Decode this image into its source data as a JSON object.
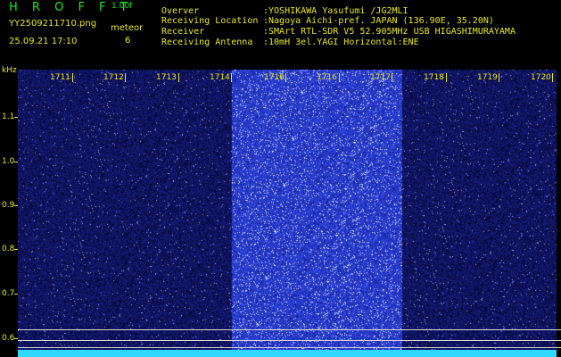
{
  "header": {
    "logo": "H R O F F T",
    "version": "1.00f",
    "filename": "YY2509211710.png",
    "meteor_label": "meteor",
    "datetime": "25.09.21 17:10",
    "meteor_count": "6"
  },
  "info": [
    {
      "key": "Overver",
      "value": ":YOSHIKAWA Yasufumi /JG2MLI"
    },
    {
      "key": "Receiving Location",
      "value": ":Nagoya Aichi-pref. JAPAN (136.90E, 35.20N)"
    },
    {
      "key": "Receiver",
      "value": ":SMArt RTL-SDR V5 52.905MHz USB HIGASHIMURAYAMA"
    },
    {
      "key": "Receiving Antenna",
      "value": ":10mH 3el.YAGI Horizontal:ENE"
    }
  ],
  "spectrogram": {
    "unit": "kHz",
    "time_labels": [
      "1711",
      "1712",
      "1713",
      "1714",
      "1716",
      "1716",
      "1717",
      "1718",
      "1719",
      "1720"
    ],
    "freq_labels": [
      "1.1",
      "1.0",
      "0.9",
      "0.8",
      "0.7",
      "0.6"
    ],
    "highlight_band": {
      "from_minute": "1714",
      "to_minute": "1717"
    }
  },
  "colors": {
    "header_green": "#17e817",
    "header_yellow": "#e8e81a",
    "axis_yellow": "#e8e81a",
    "noise_dark": "#0a0a6a",
    "noise_bright": "#1e2cc8",
    "band_blue": "#2f3ee6",
    "bottom_cyan": "#2fd8ff"
  }
}
